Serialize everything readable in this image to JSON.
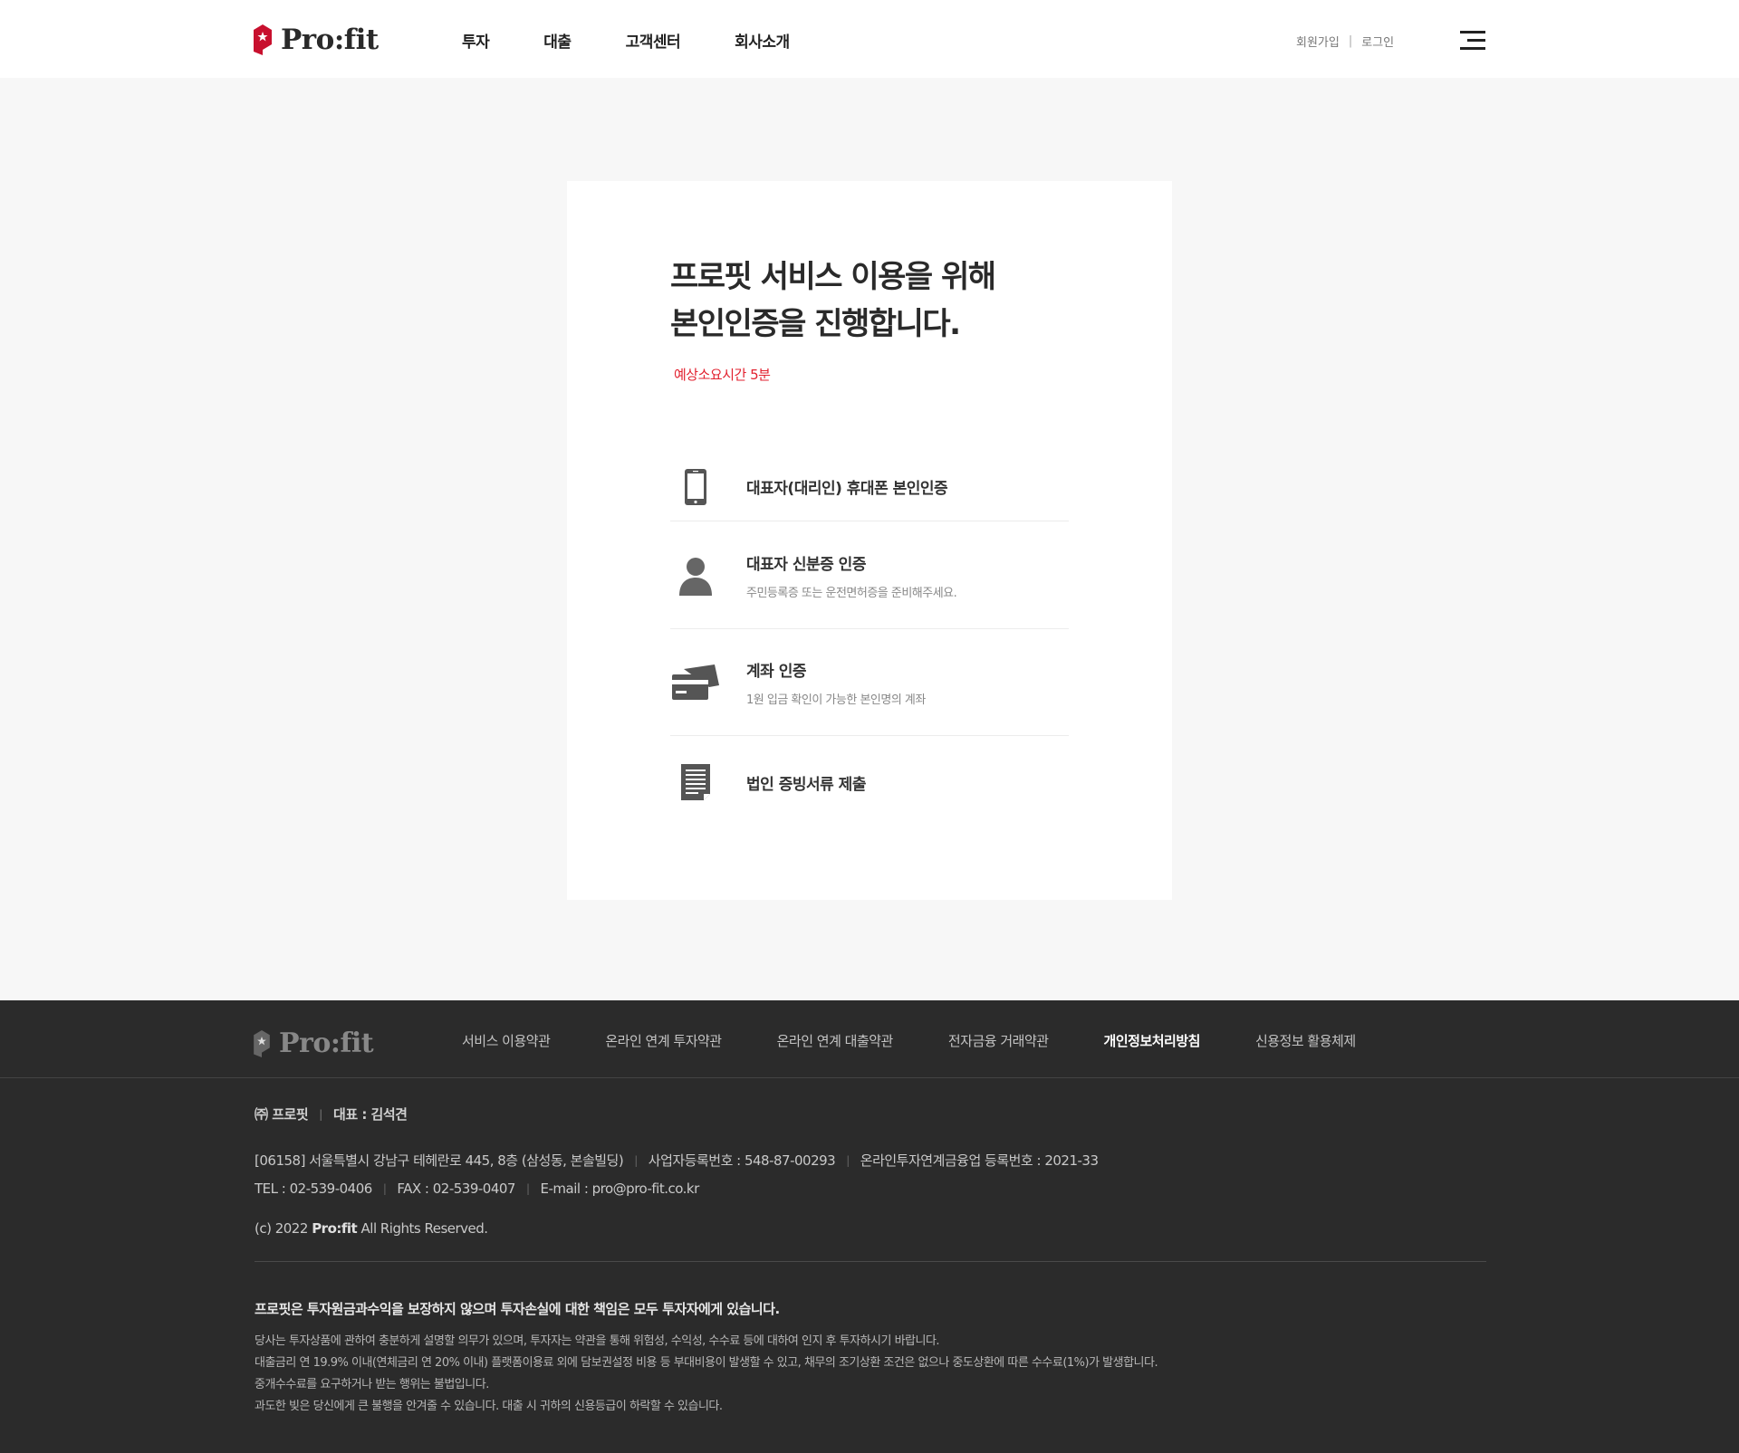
{
  "header": {
    "logo_text": "Pro:fit",
    "nav": [
      "투자",
      "대출",
      "고객센터",
      "회사소개"
    ],
    "util": {
      "signup": "회원가입",
      "login": "로그인",
      "separator": "|"
    },
    "menu_icon": "hamburger-menu-icon"
  },
  "main": {
    "title_line1": "프로핏 서비스 이용을 위해",
    "title_line2": "본인인증을 진행합니다.",
    "estimated_time": "예상소요시간 5분",
    "steps": [
      {
        "icon": "mobile-phone-icon",
        "title": "대표자(대리인) 휴대폰 본인인증",
        "desc": ""
      },
      {
        "icon": "person-icon",
        "title": "대표자 신분증 인증",
        "desc": "주민등록증 또는 운전면허증을 준비해주세요."
      },
      {
        "icon": "bank-card-icon",
        "title": "계좌 인증",
        "desc": "1원 입금 확인이 가능한 본인명의 계좌"
      },
      {
        "icon": "document-icon",
        "title": "법인 증빙서류 제출",
        "desc": ""
      }
    ]
  },
  "footer": {
    "logo_text": "Pro:fit",
    "links": [
      {
        "label": "서비스 이용약관",
        "active": false
      },
      {
        "label": "온라인 연계 투자약관",
        "active": false
      },
      {
        "label": "온라인 연계 대출약관",
        "active": false
      },
      {
        "label": "전자금융 거래약관",
        "active": false
      },
      {
        "label": "개인정보처리방침",
        "active": true
      },
      {
        "label": "신용정보 활용체제",
        "active": false
      }
    ],
    "company": "㈜ 프로핏",
    "ceo": "대표 : 김석견",
    "address": "[06158] 서울특별시 강남구 테헤란로 445, 8층 (삼성동, 본솔빌딩)",
    "biz_no": "사업자등록번호 : 548-87-00293",
    "p2p_no": "온라인투자연계금융업 등록번호 : 2021-33",
    "tel": "TEL : 02-539-0406",
    "fax": "FAX : 02-539-0407",
    "email": "E-mail : pro@pro-fit.co.kr",
    "copyright_prefix": "(c) 2022",
    "copyright_brand": "Pro:fit",
    "copyright_suffix": "All Rights Reserved.",
    "warning": "프로핏은 투자원금과수익을 보장하지 않으며 투자손실에 대한 책임은 모두 투자자에게 있습니다.",
    "disclaimer": [
      "당사는 투자상품에 관하여 충분하게 설명할 의무가 있으며, 투자자는 약관을 통해 위험성, 수익성, 수수료 등에 대하여 인지 후 투자하시기 바랍니다.",
      "대출금리 연 19.9% 이내(연체금리 연 20% 이내) 플랫폼이용료 외에 담보권설정 비용 등 부대비용이 발생할 수 있고, 채무의 조기상환 조건은 없으나 중도상환에 따른 수수료(1%)가 발생합니다.",
      "중개수수료를 요구하거나 받는 행위는 불법입니다.",
      "과도한 빚은 당신에게 큰 불행을 안겨줄 수 있습니다. 대출 시 귀하의 신용등급이 하락할 수 있습니다."
    ]
  },
  "colors": {
    "accent": "#e2222f",
    "brand_red": "#c8102e",
    "footer_bg": "#2b2b2b"
  }
}
